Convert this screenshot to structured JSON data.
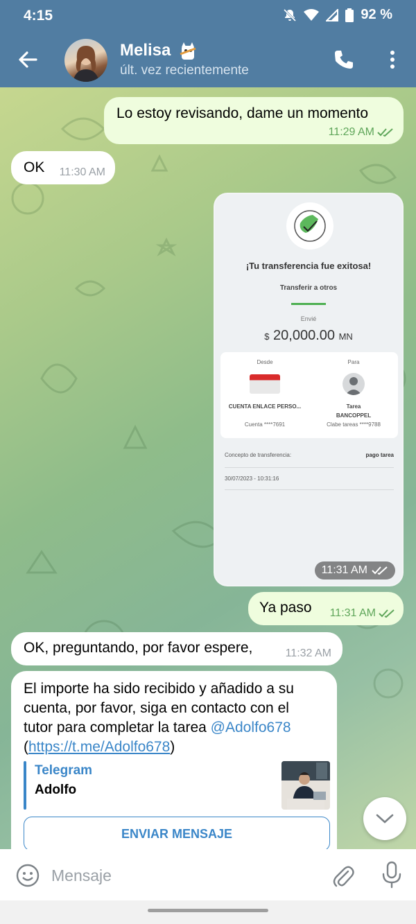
{
  "status_bar": {
    "time": "4:15",
    "battery": "92 %"
  },
  "header": {
    "name": "Melisa",
    "status": "últ. vez recientemente"
  },
  "messages": [
    {
      "text": "Lo estoy revisando, dame un momento",
      "time": "11:29 AM"
    },
    {
      "text": "OK",
      "time": "11:30 AM"
    },
    {
      "time": "11:31 AM",
      "receipt": {
        "title": "¡Tu transferencia fue exitosa!",
        "subtitle": "Transferir a otros",
        "sent_label": "Envié",
        "currency_symbol": "$",
        "amount": "20,000.00",
        "currency": "MN",
        "from_label": "Desde",
        "from_name": "CUENTA ENLACE PERSO...",
        "from_account": "Cuenta ****7691",
        "to_label": "Para",
        "to_name": "Tarea",
        "to_bank": "BANCOPPEL",
        "to_account": "Clabe tareas ****9788",
        "concept_label": "Concepto de transferencia:",
        "concept_value": "pago tarea",
        "datetime": "30/07/2023 - 10:31:16"
      }
    },
    {
      "text": "Ya paso",
      "time": "11:31 AM"
    },
    {
      "text": "OK, preguntando, por favor espere,",
      "time": "11:32 AM"
    },
    {
      "text_line1": "El importe ha sido recibido y añadido a su",
      "text_line2": "cuenta, por favor, siga en contacto con el",
      "text_line3": "tutor para completar la tarea",
      "mention": "@Adolfo678",
      "link": "https://t.me/Adolfo678",
      "preview_site": "Telegram",
      "preview_title": "Adolfo",
      "button": "ENVIAR MENSAJE"
    }
  ],
  "input": {
    "placeholder": "Mensaje"
  },
  "colors": {
    "header": "#517da2",
    "outgoing": "#effdde",
    "incoming": "#ffffff",
    "link": "#3a86c8",
    "check": "#5fa65a"
  }
}
